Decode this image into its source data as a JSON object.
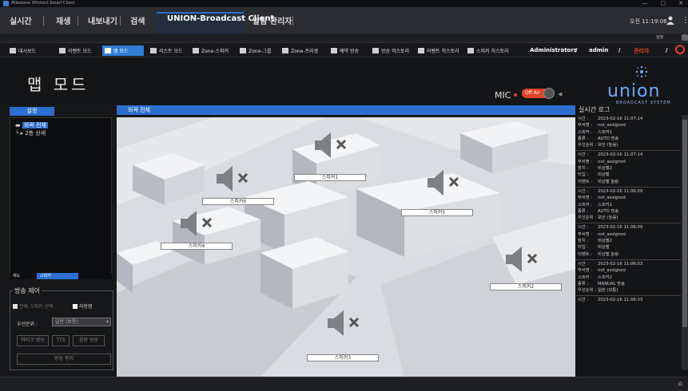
{
  "window": {
    "title": "Milestone XProtect Smart Client",
    "controls": [
      "—",
      "▢",
      "✕"
    ]
  },
  "menu": {
    "items": [
      "실시간",
      "재생",
      "내보내기",
      "검색",
      "UNION-Broadcast Client",
      "알람 관리자"
    ],
    "clock": "오전 11:19:06"
  },
  "subbar": {
    "settings_label": "설정"
  },
  "toolbar": {
    "items": [
      "대시보드",
      "이벤트 모드",
      "맵 모드",
      "리스트 모드",
      "Zone-스피커",
      "Zone-그룹",
      "Zone-프리셋",
      "예약 방송",
      "방송 히스토리",
      "이벤트 히스토리",
      "스피커 히스토리"
    ],
    "active": "맵 모드",
    "user_role": "Administrators",
    "user_id": "admin",
    "user_name": "관리자",
    "sep": "/"
  },
  "header": {
    "page_title": "맵 모드",
    "mic_label": "MIC",
    "offair_label": "Off Air",
    "brand_name": "union",
    "brand_sub": "BROADCAST SYSTEM"
  },
  "left": {
    "panel_title": "설정",
    "tree": [
      "외곽 전체",
      "2층 상세"
    ],
    "tabs": [
      "재도",
      "스피커"
    ],
    "control_title": "방송 제어",
    "chk_select_all": "전체 스피커 선택",
    "chk_auto": "자동병",
    "priority_label": "우선순위 :",
    "priority_value": "일반 (보통)",
    "btn_mic": "마이크 방송",
    "btn_tts": "TTS",
    "btn_sound": "음원 방송",
    "btn_stop": "방송 중지"
  },
  "map": {
    "title": "외곽 전체",
    "speakers": [
      "스피커1",
      "스피커2",
      "스피커3",
      "스피커4",
      "스피커5",
      "스피커6"
    ]
  },
  "log": {
    "title": "실시간 로그",
    "entries": [
      {
        "rows": [
          [
            "시간 :",
            "2023-02-16 11:07:14"
          ],
          [
            "부서명 :",
            "not_assigned"
          ],
          [
            "스피커 :",
            "스피커1"
          ],
          [
            "종류 :",
            "AUTO 방송"
          ],
          [
            "우선순위 :",
            "보안 (높음)"
          ]
        ]
      },
      {
        "rows": [
          [
            "시간 :",
            "2023-02-16 11:07:14"
          ],
          [
            "부서명 :",
            "not_assigned"
          ],
          [
            "장치 :",
            "비상벨2"
          ],
          [
            "타입 :",
            "비상벨"
          ],
          [
            "이벤트 :",
            "비상벨 눌림"
          ]
        ]
      },
      {
        "rows": [
          [
            "시간 :",
            "2023-02-16 11:06:09"
          ],
          [
            "부서명 :",
            "not_assigned"
          ],
          [
            "스피커 :",
            "스피커1"
          ],
          [
            "종류 :",
            "AUTO 방송"
          ],
          [
            "우선순위 :",
            "보안 (높음)"
          ]
        ]
      },
      {
        "rows": [
          [
            "시간 :",
            "2023-02-16 11:06:09"
          ],
          [
            "부서명 :",
            "not_assigned"
          ],
          [
            "장치 :",
            "비상벨2"
          ],
          [
            "타입 :",
            "비상벨"
          ],
          [
            "이벤트 :",
            "비상벨 눌림"
          ]
        ]
      },
      {
        "rows": [
          [
            "시간 :",
            "2023-02-16 11:06:03"
          ],
          [
            "부서명 :",
            "not_assigned"
          ],
          [
            "스피커 :",
            "스피커2"
          ],
          [
            "종류 :",
            "MANUAL 방송"
          ],
          [
            "우선순위 :",
            "일반 (보통)"
          ]
        ]
      },
      {
        "rows": [
          [
            "시간 :",
            "2023-02-16 11:06:03"
          ]
        ]
      }
    ]
  }
}
